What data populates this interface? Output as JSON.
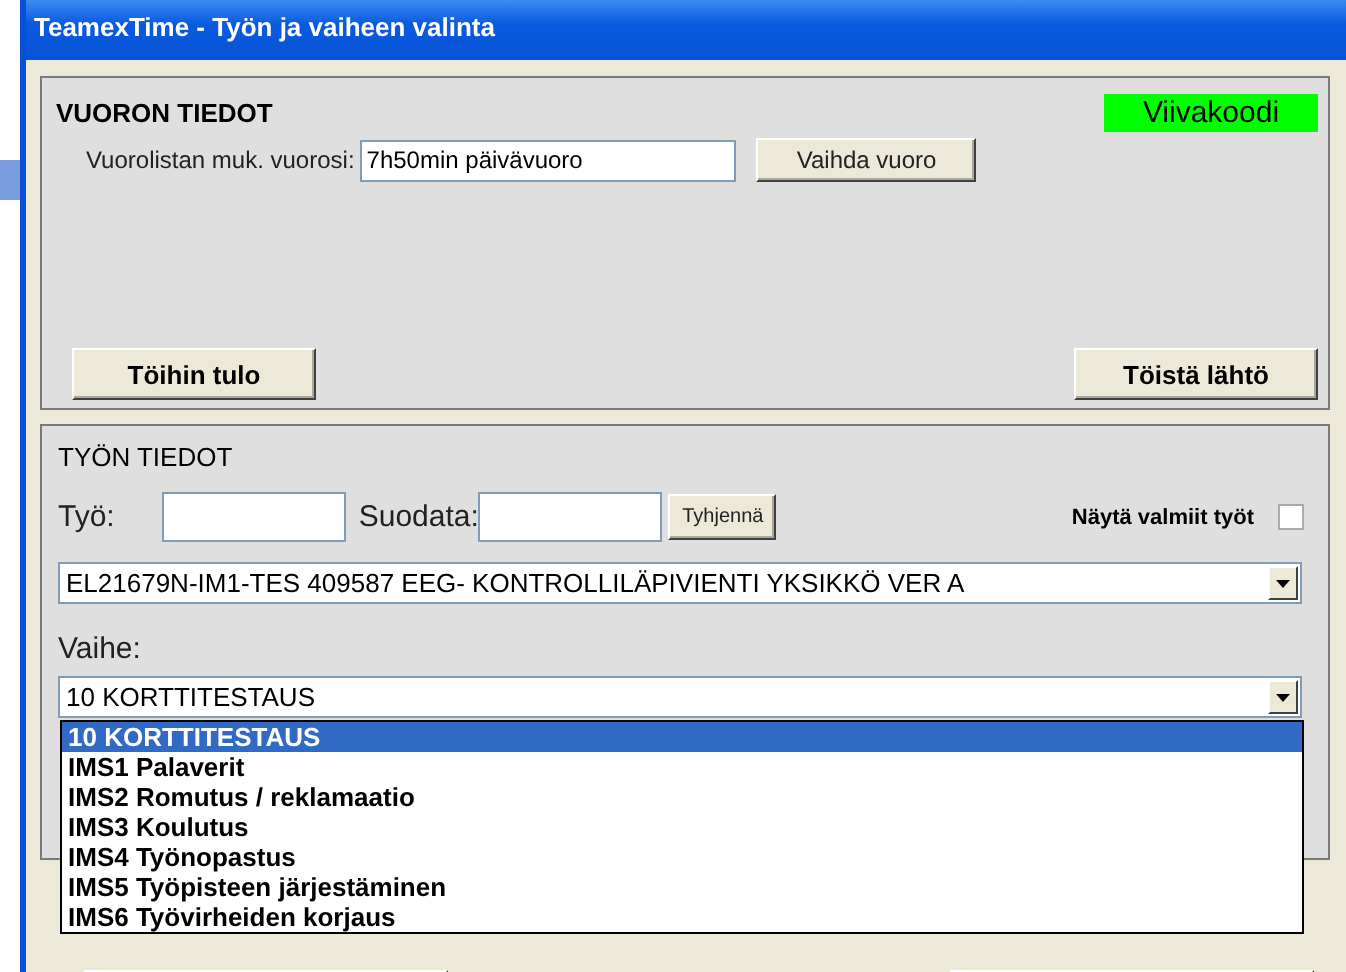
{
  "window": {
    "title": "TeamexTime - Työn ja vaiheen valinta"
  },
  "shift_panel": {
    "heading": "VUORON TIEDOT",
    "barcode_badge": "Viivakoodi",
    "shift_label": "Vuorolistan muk. vuorosi:",
    "shift_value": "7h50min päivävuoro",
    "change_button": "Vaihda vuoro",
    "buttons": [
      "Töihin tulo",
      "Töistä lähtö"
    ]
  },
  "work_panel": {
    "heading": "TYÖN TIEDOT",
    "work_label": "Työ:",
    "filter_label": "Suodata:",
    "clear_button": "Tyhjennä",
    "show_finished": {
      "label": "Näytä valmiit työt",
      "checked": false
    },
    "job_combo": "EL21679N-IM1-TES 409587 EEG- KONTROLLILÄPIVIENTI YKSIKKÖ VER A",
    "phase_label": "Vaihe:",
    "phase_combo": "10 KORTTITESTAUS",
    "phase_options": [
      {
        "label": "10 KORTTITESTAUS",
        "selected": true
      },
      {
        "label": "IMS1 Palaverit",
        "selected": false
      },
      {
        "label": "IMS2 Romutus / reklamaatio",
        "selected": false
      },
      {
        "label": "IMS3 Koulutus",
        "selected": false
      },
      {
        "label": "IMS4 Työnopastus",
        "selected": false
      },
      {
        "label": "IMS5 Työpisteen järjestäminen",
        "selected": false
      },
      {
        "label": "IMS6 Työvirheiden korjaus",
        "selected": false
      }
    ]
  }
}
